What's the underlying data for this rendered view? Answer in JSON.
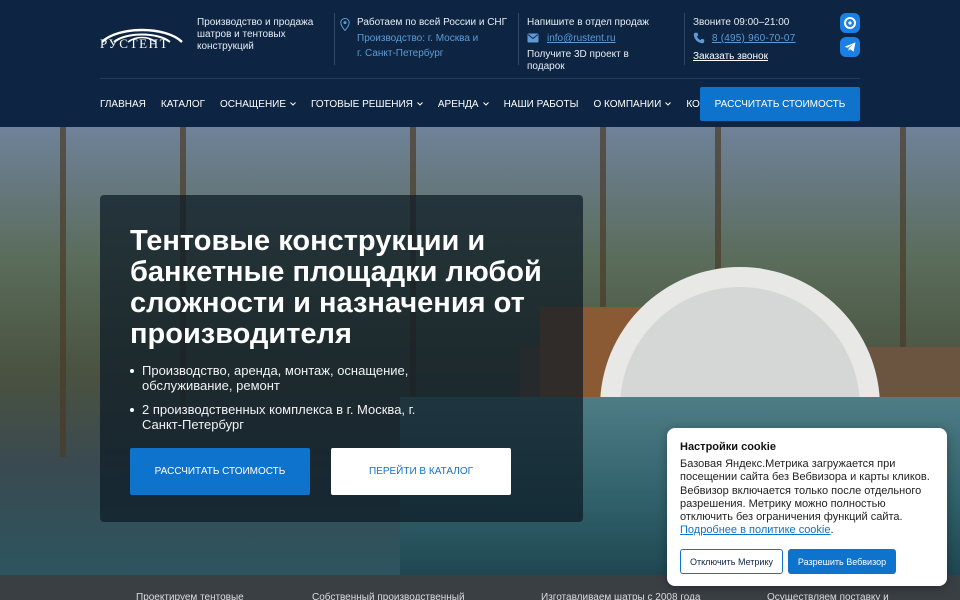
{
  "brand": {
    "name": "РУСТЕНТ",
    "tagline": "Производство и продажа шатров и тентовых конструкций"
  },
  "contacts": {
    "location_title": "Работаем по всей России и СНГ",
    "location_link_1": "Производство: г. Москва и",
    "location_link_2": "г. Санкт-Петербург",
    "mail_label": "Напишите в отдел продаж",
    "email": "info@rustent.ru",
    "project_text": "Получите 3D проект в подарок",
    "call_label": "Звоните 09:00–21:00",
    "phone": "8 (495) 960-70-07",
    "callback": "Заказать звонок"
  },
  "nav": {
    "items": [
      {
        "label": "ГЛАВНАЯ",
        "dropdown": false
      },
      {
        "label": "КАТАЛОГ",
        "dropdown": false
      },
      {
        "label": "ОСНАЩЕНИЕ",
        "dropdown": true
      },
      {
        "label": "ГОТОВЫЕ РЕШЕНИЯ",
        "dropdown": true
      },
      {
        "label": "АРЕНДА",
        "dropdown": true
      },
      {
        "label": "НАШИ РАБОТЫ",
        "dropdown": false
      },
      {
        "label": "О КОМПАНИИ",
        "dropdown": true
      },
      {
        "label": "КОНТАКТЫ",
        "dropdown": false
      }
    ],
    "cta": "РАССЧИТАТЬ СТОИМОСТЬ"
  },
  "hero": {
    "title": "Тентовые конструкции и банкетные площадки любой сложности и назначения от производителя",
    "bullets": [
      "Производство, аренда, монтаж, оснащение, обслуживание, ремонт",
      "2 производственных комплекса в г. Москва, г. Санкт-Петербург"
    ],
    "btn_primary": "РАССЧИТАТЬ СТОИМОСТЬ",
    "btn_secondary": "ПЕРЕЙТИ В КАТАЛОГ"
  },
  "strip": {
    "items": [
      "Проектируем тентовые",
      "Собственный производственный",
      "Изготавливаем шатры с 2008 года",
      "Осуществляем поставку и"
    ]
  },
  "cookie": {
    "title": "Настройки cookie",
    "text": "Базовая Яндекс.Метрика загружается при посещении сайта без Вебвизора и карты кликов. Вебвизор включается только после отдельного разрешения. Метрику можно полностью отключить без ограничения функций сайта. ",
    "link": "Подробнее в политике cookie",
    "link_suffix": ".",
    "btn_disable": "Отключить Метрику",
    "btn_allow": "Разрешить Вебвизор"
  },
  "colors": {
    "header_bg": "#0d2542",
    "accent": "#0d73cc",
    "link": "#5e9bd6"
  },
  "icons": [
    "location-pin-icon",
    "mail-icon",
    "phone-icon",
    "max-messenger-icon",
    "telegram-icon",
    "chevron-down-icon"
  ]
}
